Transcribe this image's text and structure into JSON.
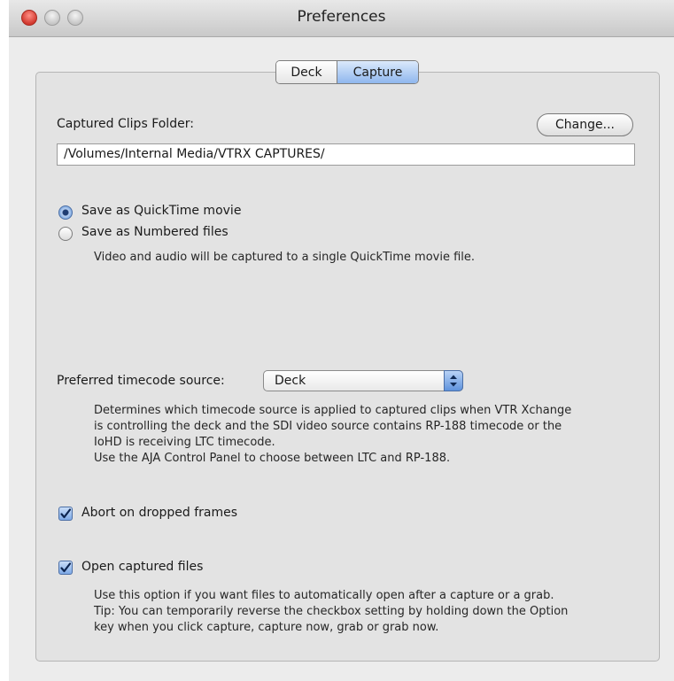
{
  "window": {
    "title": "Preferences"
  },
  "tabs": [
    {
      "label": "Deck",
      "selected": false
    },
    {
      "label": "Capture",
      "selected": true
    }
  ],
  "captured_clips": {
    "label": "Captured Clips Folder:",
    "change_button": "Change...",
    "path": "/Volumes/Internal Media/VTRX CAPTURES/"
  },
  "save_mode": {
    "options": [
      {
        "label": "Save as QuickTime movie",
        "selected": true
      },
      {
        "label": "Save as Numbered files",
        "selected": false
      }
    ],
    "help": "Video and audio will be captured to a single QuickTime movie file."
  },
  "timecode": {
    "label": "Preferred timecode source:",
    "value": "Deck",
    "help": [
      "Determines which timecode source is applied to captured clips when VTR Xchange",
      "is controlling the deck and the SDI video source contains RP-188 timecode or the",
      "IoHD is receiving LTC timecode.",
      "Use the AJA Control Panel to choose between LTC and RP-188."
    ]
  },
  "abort_dropped": {
    "label": "Abort on dropped frames",
    "checked": true
  },
  "open_captured": {
    "label": "Open captured files",
    "checked": true,
    "help": [
      "Use this option if you want files to automatically open after a capture or a grab.",
      "Tip: You can temporarily reverse the checkbox setting by holding down the Option",
      "key when you click capture, capture now, grab or grab now."
    ]
  },
  "colors": {
    "accent_blue": "#8fb7ee",
    "window_bg": "#ececec"
  },
  "icons": {
    "checkmark": "check-icon",
    "popup_arrows": "up-down-arrows-icon"
  }
}
